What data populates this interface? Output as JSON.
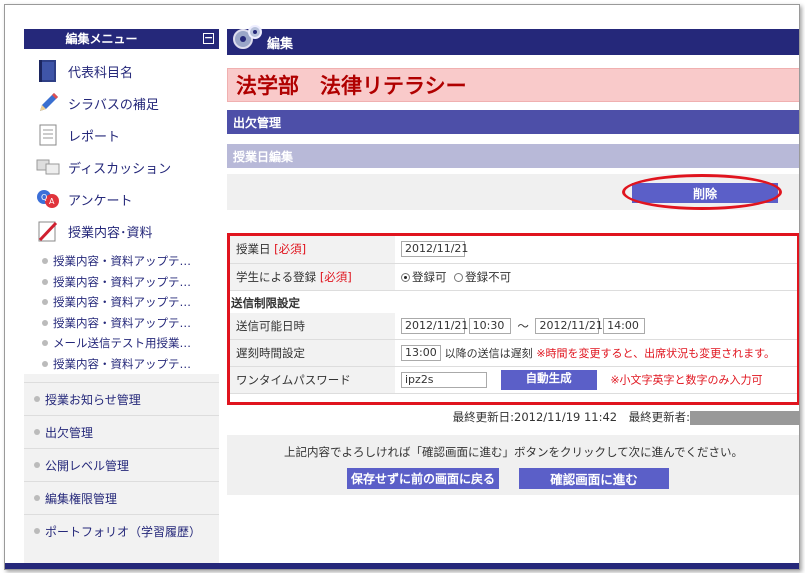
{
  "sidebar": {
    "title": "編集メニュー",
    "collapse": "−",
    "items": [
      {
        "label": "代表科目名",
        "icon": "book-icon"
      },
      {
        "label": "シラバスの補足",
        "icon": "pencil-icon"
      },
      {
        "label": "レポート",
        "icon": "document-icon"
      },
      {
        "label": "ディスカッション",
        "icon": "monitors-icon"
      },
      {
        "label": "アンケート",
        "icon": "qa-icon"
      },
      {
        "label": "授業内容･資料",
        "icon": "notebook-icon"
      }
    ],
    "sub_items": [
      "授業内容・資料アップテ…",
      "授業内容・資料アップテ…",
      "授業内容・資料アップテ…",
      "授業内容・資料アップテ…",
      "メール送信テスト用授業…",
      "授業内容・資料アップテ…"
    ],
    "sections": [
      "授業お知らせ管理",
      "出欠管理",
      "公開レベル管理",
      "編集権限管理",
      "ポートフォリオ（学習履歴）"
    ]
  },
  "header": {
    "label": "編集",
    "icon": "gears-icon"
  },
  "course_title": "法学部　法律リテラシー",
  "attendance_bar": "出欠管理",
  "edit_bar": "授業日編集",
  "delete_button": "削除",
  "form": {
    "class_date_label": "授業日",
    "required": "[必須]",
    "class_date_value": "2012/11/21",
    "student_reg_label": "学生による登録",
    "reg_allowed": "登録可",
    "reg_denied": "登録不可",
    "section_title": "送信制限設定",
    "send_period_label": "送信可能日時",
    "start_date": "2012/11/21",
    "start_time": "10:30",
    "tilde": "〜",
    "end_date": "2012/11/21",
    "end_time": "14:00",
    "late_label": "遅刻時間設定",
    "late_time": "13:00",
    "late_suffix": "以降の送信は遅刻",
    "late_note": "※時間を変更すると、出席状況も変更されます。",
    "otp_label": "ワンタイムパスワード",
    "otp_value": "ipz2s",
    "generate_button": "自動生成",
    "otp_note": "※小文字英字と数字のみ入力可"
  },
  "last_updated": "最終更新日:2012/11/19 11:42　最終更新者:",
  "confirm": {
    "message": "上記内容でよろしければ「確認画面に進む」ボタンをクリックして次に進んでください。",
    "back_button": "保存せずに前の画面に戻る",
    "next_button": "確認画面に進む"
  },
  "colors": {
    "navy": "#25287a",
    "accent": "#5b5fc8",
    "alert": "#e0141e",
    "title_bg": "#f9caca"
  }
}
